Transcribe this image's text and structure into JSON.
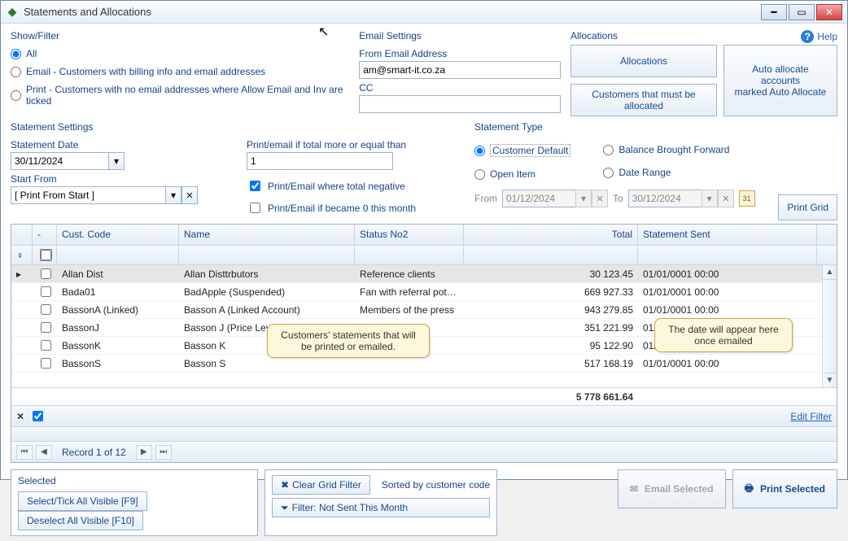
{
  "window": {
    "title": "Statements and Allocations"
  },
  "help": "Help",
  "show_filter": {
    "label": "Show/Filter",
    "all": "All",
    "email": "Email - Customers with billing info and email addresses",
    "print": "Print - Customers with no email addresses where Allow Email and Inv are ticked"
  },
  "email_settings": {
    "label": "Email Settings",
    "from_label": "From Email Address",
    "from_value": "am@smart-it.co.za",
    "cc_label": "CC",
    "cc_value": ""
  },
  "allocations": {
    "label": "Allocations",
    "btn_alloc": "Allocations",
    "btn_customers": "Customers that must be allocated",
    "btn_auto": "Auto allocate accounts\nmarked Auto Allocate"
  },
  "statement_settings": {
    "label": "Statement Settings",
    "date_label": "Statement Date",
    "date_value": "30/11/2024",
    "start_label": "Start From",
    "start_value": "[ Print From Start ]"
  },
  "print_opts": {
    "threshold_label": "Print/email if total more or equal than",
    "threshold_value": "1",
    "neg_label": "Print/Email where total negative",
    "zero_label": "Print/Email if became 0 this month"
  },
  "statement_type": {
    "label": "Statement Type",
    "customer_default": "Customer Default",
    "open_item": "Open Item",
    "bbf": "Balance Brought Forward",
    "date_range": "Date Range",
    "from_label": "From",
    "from_value": "01/12/2024",
    "to_label": "To",
    "to_value": "30/12/2024"
  },
  "print_grid_btn": "Print Grid",
  "grid": {
    "headers": {
      "check": "-",
      "code": "Cust. Code",
      "name": "Name",
      "status": "Status No2",
      "total": "Total",
      "sent": "Statement Sent"
    },
    "rows": [
      {
        "code": "Allan Dist",
        "name": "Allan Disttrbutors",
        "status": "Reference clients",
        "total": "30 123.45",
        "sent": "01/01/0001 00:00",
        "selected": true
      },
      {
        "code": "Bada01",
        "name": "BadApple (Suspended)",
        "status": "Fan with referral potential",
        "total": "669 927.33",
        "sent": "01/01/0001 00:00"
      },
      {
        "code": "BassonA (Linked)",
        "name": "Basson A (Linked Account)",
        "status": "Members of the press",
        "total": "943 279.85",
        "sent": "01/01/0001 00:00"
      },
      {
        "code": "BassonJ",
        "name": "Basson J (Price Level 3)",
        "status": "",
        "total": "351 221.99",
        "sent": "01/01/0001 00:00"
      },
      {
        "code": "BassonK",
        "name": "Basson K",
        "status": "",
        "total": "95 122.90",
        "sent": "01/01/0001 00:00"
      },
      {
        "code": "BassonS",
        "name": "Basson S",
        "status": "",
        "total": "517 168.19",
        "sent": "01/01/0001 00:00"
      }
    ],
    "grand_total": "5 778 661.64"
  },
  "callouts": {
    "left": "Customers' statements that will be printed or emailed.",
    "right": "The date will appear here once emailed"
  },
  "edit_filter": "Edit Filter",
  "record": "Record 1 of 12",
  "selected_panel": {
    "title": "Selected",
    "tick_all": "Select/Tick All Visible [F9]",
    "deselect": "Deselect All Visible [F10]"
  },
  "filter_panel": {
    "clear": "Clear Grid Filter",
    "sorted": "Sorted by customer code",
    "filter_month": "Filter: Not Sent This Month"
  },
  "actions": {
    "email": "Email Selected",
    "print": "Print Selected"
  }
}
